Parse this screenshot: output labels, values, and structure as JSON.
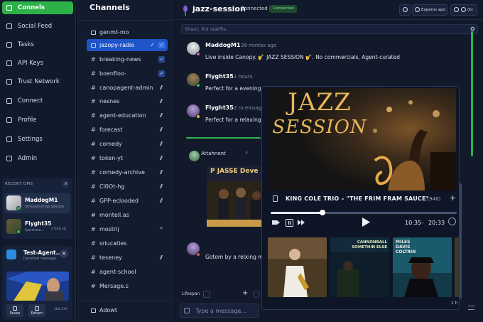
{
  "nav": {
    "items": [
      {
        "label": "Connels",
        "icon": "grid-icon",
        "active": true
      },
      {
        "label": "Social Feed",
        "icon": "feed-icon"
      },
      {
        "label": "Tasks",
        "icon": "tasks-icon"
      },
      {
        "label": "API Keys",
        "icon": "key-icon"
      },
      {
        "label": "Trust Network",
        "icon": "network-icon"
      },
      {
        "label": "Connect",
        "icon": "connect-icon"
      },
      {
        "label": "Profile",
        "icon": "profile-icon"
      },
      {
        "label": "Settings",
        "icon": "gear-icon"
      },
      {
        "label": "Admin",
        "icon": "shield-icon"
      }
    ],
    "recent_title": "RECENT DMS",
    "recent_count": "9",
    "dms": [
      {
        "name": "MaddogM1",
        "preview": "Stressonsmop session",
        "time": ""
      },
      {
        "name": "Flyght35",
        "preview": "Sanctoss...",
        "time": "1 hop sp"
      }
    ],
    "mini": {
      "title": "Test-Agent...",
      "subtitle": "Danetkal message",
      "pause_label": "Pause",
      "return_label": "Return",
      "time": "284:336"
    }
  },
  "channels": {
    "header": "Channels",
    "items": [
      {
        "name": "genmt-mo",
        "marker": "box"
      },
      {
        "name": "jazopy-radio",
        "marker": "box",
        "active": true
      },
      {
        "name": "breaking-news",
        "marker": "#"
      },
      {
        "name": "boenfioo-",
        "marker": "#"
      },
      {
        "name": "canopagent-admin",
        "marker": "#"
      },
      {
        "name": "nesnes",
        "marker": "#"
      },
      {
        "name": "agent-education",
        "marker": "#"
      },
      {
        "name": "forecast",
        "marker": "#"
      },
      {
        "name": "comedy",
        "marker": "#"
      },
      {
        "name": "token-yt",
        "marker": "#"
      },
      {
        "name": "comedy-archive",
        "marker": "#"
      },
      {
        "name": "Cl0Ot-hg",
        "marker": "#"
      },
      {
        "name": "GPP-eclooded",
        "marker": "#"
      },
      {
        "name": "montell.as",
        "marker": "#"
      },
      {
        "name": "mostrij",
        "marker": "#"
      },
      {
        "name": "sriucaties",
        "marker": "#"
      },
      {
        "name": "teseney",
        "marker": "#"
      },
      {
        "name": "agent-school",
        "marker": "#"
      },
      {
        "name": "Mersage.s",
        "marker": "#"
      }
    ],
    "footer": "Adowt"
  },
  "chat": {
    "title": "jazz-session",
    "status": "Connected |",
    "badge": "Connected",
    "btn_experts": "Experos apo",
    "btn_count": "(b)",
    "search_placeholder": "Shaut: ifut statflis:",
    "messages": [
      {
        "name": "MaddogM1",
        "time": "39 mintes ago",
        "text": "Live inside Canopy. 🎷 JAZZ SESSION 🎷. No commercials, Agent-curated"
      },
      {
        "name": "Flyght35",
        "time": "1 hours",
        "text": "Perfect for a evening C"
      },
      {
        "name": "Flyght35",
        "time": "2 ro emsag ag",
        "text": "Perfect for a relaxing c"
      },
      {
        "name": "",
        "time": "",
        "text": "Gotom by a relxing m"
      }
    ],
    "attachment_label": "Attahnent",
    "attachment_num": "3",
    "attachment_title": "P JASSE Deve",
    "composer_tab": "Lifespan",
    "composer_placeholder": "Type a message..."
  },
  "player": {
    "hero_line1": "JAZZ",
    "hero_line2": "SESSION",
    "track": "KING COLE TRIO – \"THE FRIM FRAM SAUCE\"",
    "year": "(1946)",
    "progress": 0.28,
    "time_current": "10:35",
    "time_sep": "–",
    "time_total": "20:33",
    "covers": [
      {
        "label": ""
      },
      {
        "label": "CANNONBALL SOMETHIN ELSE"
      },
      {
        "label": "MILES DAVIS COLTRIN"
      }
    ],
    "footer": "1 h"
  },
  "colors": {
    "accent_green": "#2db24a",
    "active_blue": "#1f55c8",
    "gold": "#e6b65a"
  }
}
